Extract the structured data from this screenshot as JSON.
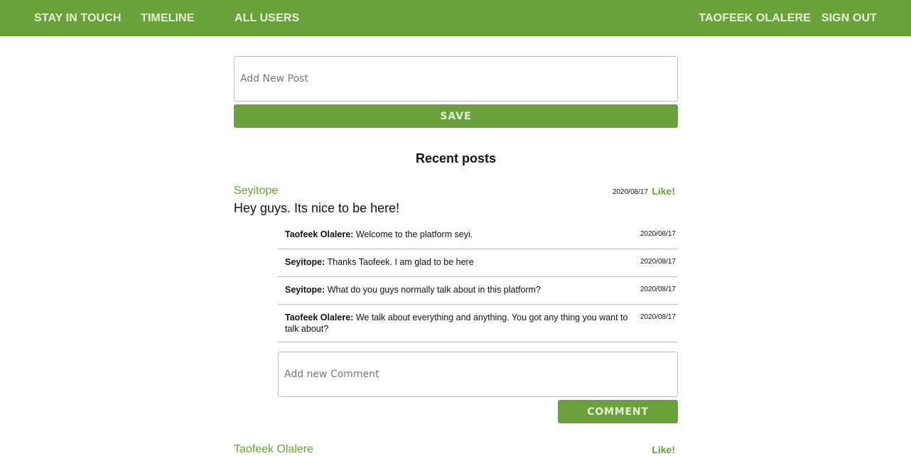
{
  "nav": {
    "brand": "STAY IN TOUCH",
    "timeline": "TIMELINE",
    "all_users": "ALL USERS",
    "user_name": "TAOFEEK OLALERE",
    "sign_out": "SIGN OUT"
  },
  "new_post": {
    "placeholder": "Add New Post",
    "save_label": "SAVE"
  },
  "section_title": "Recent posts",
  "posts": [
    {
      "author": "Seyitope",
      "date": "2020/08/17",
      "like_label": "Like!",
      "body": "Hey guys. Its nice to be here!",
      "comments": [
        {
          "author": "Taofeek Olalere:",
          "text": "Welcome to the platform seyi.",
          "date": "2020/08/17"
        },
        {
          "author": "Seyitope:",
          "text": "Thanks Taofeek. I am glad to be here",
          "date": "2020/08/17"
        },
        {
          "author": "Seyitope:",
          "text": "What do you guys normally talk about in this platform?",
          "date": "2020/08/17"
        },
        {
          "author": "Taofeek Olalere:",
          "text": "We talk about everything and anything. You got any thing you want to talk about?",
          "date": "2020/08/17"
        }
      ],
      "comment_placeholder": "Add new Comment",
      "comment_button": "COMMENT"
    },
    {
      "author": "Taofeek Olalere",
      "like_label": "Like!"
    }
  ],
  "colors": {
    "accent": "#6aa13b",
    "accent_text": "#e6f0d9",
    "border": "#bdbdbd"
  }
}
